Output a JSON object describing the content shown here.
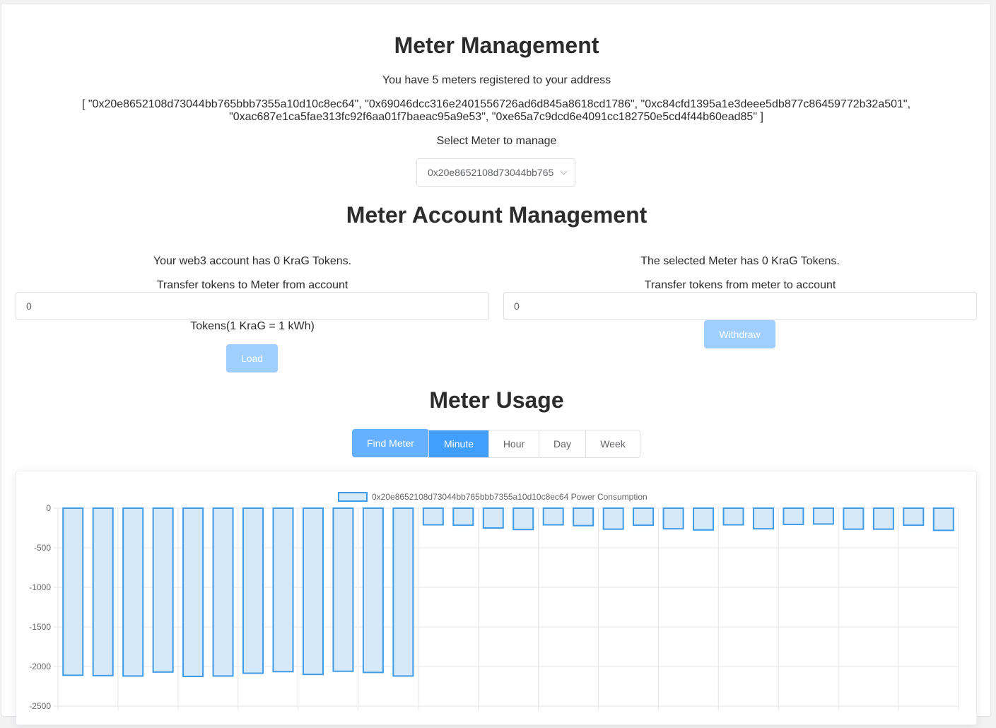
{
  "header": {
    "title": "Meter Management",
    "registered_text": "You have 5 meters registered to your address",
    "addresses_text": "[ \"0x20e8652108d73044bb765bbb7355a10d10c8ec64\", \"0x69046dcc316e2401556726ad6d845a8618cd1786\", \"0xc84cfd1395a1e3deee5db877c86459772b32a501\", \"0xac687e1ca5fae313fc92f6aa01f7baeac95a9e53\", \"0xe65a7c9dcd6e4091cc182750e5cd4f44b60ead85\" ]",
    "select_label": "Select Meter to manage",
    "select_value": "0x20e8652108d73044bb765"
  },
  "account": {
    "title": "Meter Account Management",
    "left": {
      "balance_text": "Your web3 account has 0 KraG Tokens.",
      "transfer_label": "Transfer tokens to Meter from account",
      "input_value": "0",
      "unit_text": "Tokens(1 KraG = 1 kWh)",
      "button_label": "Load"
    },
    "right": {
      "balance_text": "The selected Meter has 0 KraG Tokens.",
      "transfer_label": "Transfer tokens from meter to account",
      "input_value": "0",
      "button_label": "Withdraw"
    }
  },
  "usage": {
    "title": "Meter Usage",
    "find_button": "Find Meter",
    "tabs": [
      "Minute",
      "Hour",
      "Day",
      "Week"
    ],
    "active_tab": "Minute"
  },
  "colors": {
    "bar_fill": "#d6e9fb",
    "bar_stroke": "#3f9be6",
    "grid": "#e5e5e5",
    "primary": "#409eff",
    "primary_light": "#66b1ff",
    "disabled": "#a0cfff"
  },
  "chart_data": {
    "type": "bar",
    "legend": "0x20e8652108d73044bb765bbb7355a10d10c8ec64 Power Consumption",
    "legend_position": "top-center",
    "y_ticks": [
      "0",
      "-500",
      "-1000",
      "-1500",
      "-2000",
      "-2500"
    ],
    "ylim": [
      -2500,
      0
    ],
    "grid": true,
    "series": [
      {
        "name": "0x20e8652108d73044bb765bbb7355a10d10c8ec64 Power Consumption",
        "values": [
          -2110,
          -2115,
          -2120,
          -2070,
          -2125,
          -2120,
          -2085,
          -2065,
          -2100,
          -2060,
          -2075,
          -2120,
          -210,
          -215,
          -250,
          -270,
          -210,
          -220,
          -265,
          -215,
          -260,
          -275,
          -210,
          -260,
          -205,
          -200,
          -265,
          -265,
          -215,
          -280
        ]
      }
    ]
  }
}
